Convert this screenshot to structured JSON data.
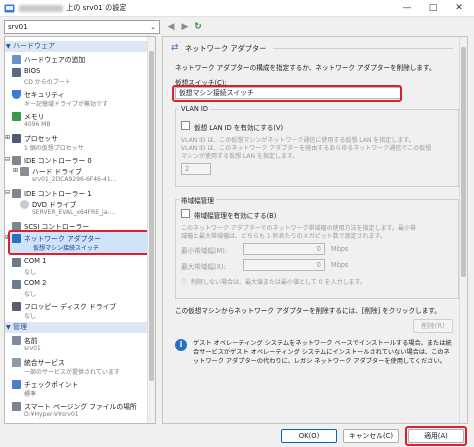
{
  "window": {
    "title": "上の srv01 の設定",
    "controls": {
      "minimize": "—",
      "maximize": "□",
      "close": "✕"
    }
  },
  "toolbar": {
    "vm_name": "srv01"
  },
  "sidebar": {
    "hardware_header": "ハードウェア",
    "management_header": "管理",
    "items": [
      {
        "label": "ハードウェアの追加",
        "sub": ""
      },
      {
        "label": "BIOS",
        "sub": "CD からのブート"
      },
      {
        "label": "セキュリティ",
        "sub": "キー記憶域ドライブが無効です"
      },
      {
        "label": "メモリ",
        "sub": "4096 MB"
      },
      {
        "label": "プロセッサ",
        "sub": "1 個の仮想プロセッサ"
      },
      {
        "label": "IDE コントローラー 0",
        "sub": ""
      },
      {
        "label": "ハード ドライブ",
        "sub": "srv01_2DCA9296-6F46-41..."
      },
      {
        "label": "IDE コントローラー 1",
        "sub": ""
      },
      {
        "label": "DVD ドライブ",
        "sub": "SERVER_EVAL_x64FRE_ja-..."
      },
      {
        "label": "SCSI コントローラー",
        "sub": ""
      },
      {
        "label": "ネットワーク アダプター",
        "sub": "仮想マシン接続スイッチ"
      },
      {
        "label": "COM 1",
        "sub": "なし"
      },
      {
        "label": "COM 2",
        "sub": "なし"
      },
      {
        "label": "フロッピー ディスク ドライブ",
        "sub": "なし"
      },
      {
        "label": "名前",
        "sub": "srv01"
      },
      {
        "label": "統合サービス",
        "sub": "一部のサービスが提供されています"
      },
      {
        "label": "チェックポイント",
        "sub": "標準"
      },
      {
        "label": "スマート ページング ファイルの場所",
        "sub": "D:¥Hyper-V¥srv01"
      }
    ]
  },
  "panel": {
    "section_title": "ネットワーク アダプター",
    "description": "ネットワーク アダプターの構成を指定するか、ネットワーク アダプターを削除します。",
    "switch_label": "仮想スイッチ(C):",
    "switch_value": "仮想マシン接続スイッチ",
    "vlan": {
      "title": "VLAN ID",
      "checkbox_label": "仮想 LAN ID を有効にする(V)",
      "desc1": "VLAN ID は、この仮想マシンがネットワーク通信に使用する仮想 LAN を指定します。",
      "desc2": "VLAN ID は、このネットワーク アダプターを経由するあらゆるネットワーク通信でこの仮想",
      "desc3": "マシンが使用する仮想 LAN を指定します。",
      "value": "2"
    },
    "bandwidth": {
      "title": "帯域幅管理",
      "checkbox_label": "帯域幅管理を有効にする(B)",
      "desc1": "このネットワーク アダプターでのネットワーク帯域幅の使用方法を指定します。最小帯",
      "desc2": "域幅と最大帯域幅は、どちらも 1 秒あたりのメガビット数で測定されます。",
      "min_label": "最小帯域幅(M):",
      "min_value": "0",
      "max_label": "最大帯域幅(X):",
      "max_value": "0",
      "unit": "Mbps",
      "note": "制限しない場合は、最大値または最小値として 0 を入力します。"
    },
    "remove_text": "この仮想マシンからネットワーク アダプターを削除するには、[削除] をクリックします。",
    "remove_button": "削除(R)",
    "info_line1": "ゲスト オペレーティング システムをネットワーク ベースでインストールする場合、または統",
    "info_line2": "合サービスがゲスト オペレーティング システムにインストールされていない場合は、このネ",
    "info_line3": "ットワーク アダプターの代わりに、レガシ ネットワーク アダプターを使用してください。"
  },
  "footer": {
    "ok": "OK(O)",
    "cancel": "キャンセル(C)",
    "apply": "適用(A)"
  },
  "colors": {
    "highlight_red": "#d9212f",
    "selection_blue": "#cfe3fa",
    "header_blue": "#1a4f99"
  }
}
